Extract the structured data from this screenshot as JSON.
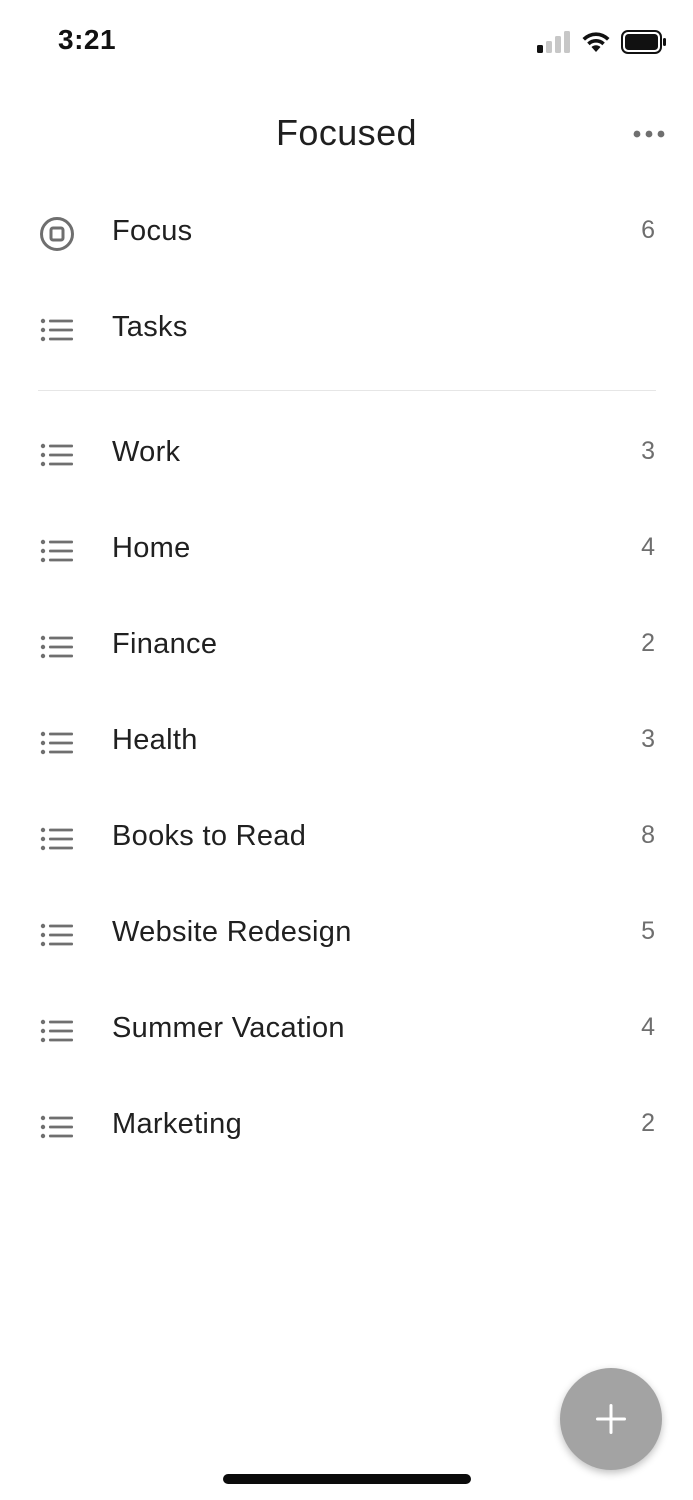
{
  "status_bar": {
    "time": "3:21",
    "signal_icon": "cellular-signal-icon",
    "wifi_icon": "wifi-icon",
    "battery_icon": "battery-icon"
  },
  "header": {
    "title": "Focused",
    "more_icon": "more-horizontal-icon"
  },
  "smart_lists": [
    {
      "label": "Focus",
      "count": "6",
      "icon": "focus-target-icon"
    },
    {
      "label": "Tasks",
      "count": "",
      "icon": "list-icon"
    }
  ],
  "lists": [
    {
      "label": "Work",
      "count": "3",
      "icon": "list-icon"
    },
    {
      "label": "Home",
      "count": "4",
      "icon": "list-icon"
    },
    {
      "label": "Finance",
      "count": "2",
      "icon": "list-icon"
    },
    {
      "label": "Health",
      "count": "3",
      "icon": "list-icon"
    },
    {
      "label": "Books to Read",
      "count": "8",
      "icon": "list-icon"
    },
    {
      "label": "Website Redesign",
      "count": "5",
      "icon": "list-icon"
    },
    {
      "label": "Summer Vacation",
      "count": "4",
      "icon": "list-icon"
    },
    {
      "label": "Marketing",
      "count": "2",
      "icon": "list-icon"
    }
  ],
  "fab": {
    "icon": "plus-icon"
  },
  "colors": {
    "fab_background": "#a3a3a3",
    "icon_gray": "#6f6f6f",
    "count_gray": "#6e6e6e",
    "divider": "#e6e6e6"
  }
}
